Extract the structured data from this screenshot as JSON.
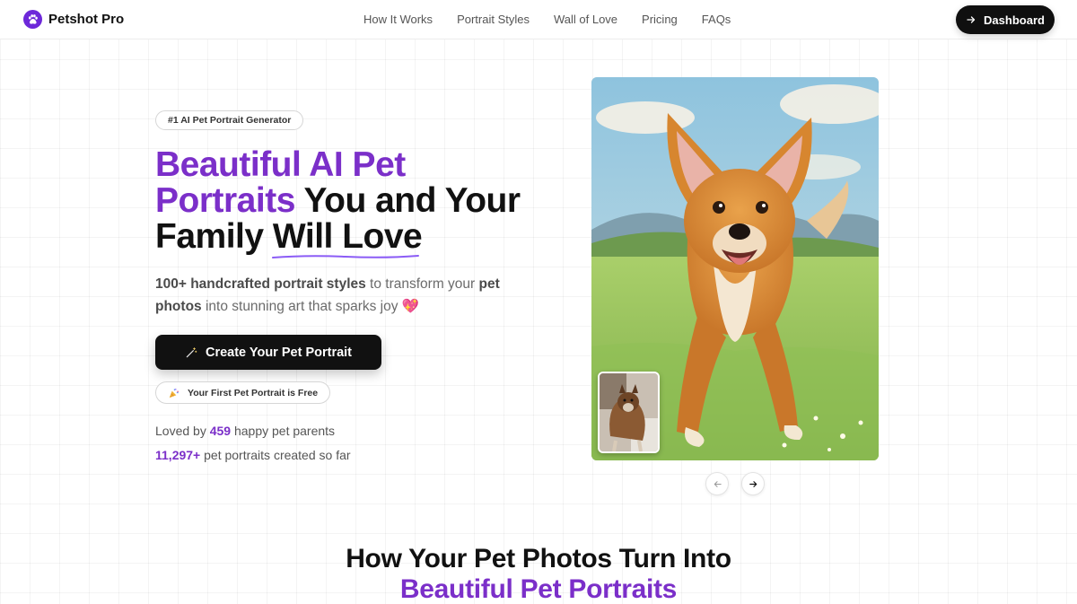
{
  "header": {
    "brand": "Petshot Pro",
    "nav": [
      "How It Works",
      "Portrait Styles",
      "Wall of Love",
      "Pricing",
      "FAQs"
    ],
    "dashboard_label": "Dashboard"
  },
  "hero": {
    "badge": "#1 AI Pet Portrait Generator",
    "headline_purple": "Beautiful AI Pet Portraits",
    "headline_mid": " You and Your Family ",
    "headline_underlined": "Will Love",
    "sub_bold1": "100+ handcrafted portrait styles",
    "sub_text1": " to transform your ",
    "sub_bold2": "pet photos",
    "sub_text2": " into stunning art that sparks joy",
    "sub_emoji": "💖",
    "cta_label": "Create Your Pet Portrait",
    "free_label": "Your First Pet Portrait is Free",
    "stat1_prefix": "Loved by ",
    "stat1_num": "459",
    "stat1_suffix": " happy pet parents",
    "stat2_num": "11,297+",
    "stat2_suffix": " pet portraits created so far"
  },
  "section": {
    "title_line1": "How Your Pet Photos Turn Into",
    "title_line2": "Beautiful Pet Portraits"
  },
  "colors": {
    "accent": "#7b2fc9",
    "dark_button": "#111111"
  },
  "icons": {
    "logo": "paw-icon",
    "dashboard": "arrow-right-icon",
    "cta": "magic-wand-icon",
    "free": "party-popper-icon",
    "carousel_prev": "arrow-left-icon",
    "carousel_next": "arrow-right-icon"
  }
}
